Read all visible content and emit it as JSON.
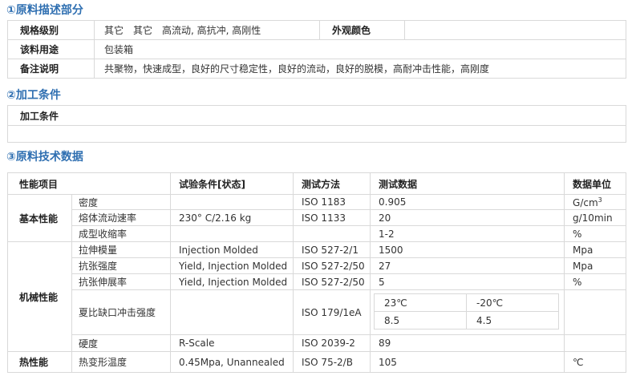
{
  "section1": {
    "title": "①原料描述部分",
    "rows": [
      {
        "label": "规格级别",
        "value": "其它　其它　高流动, 高抗冲, 高刚性",
        "label2": "外观颜色",
        "value2": ""
      },
      {
        "label": "该料用途",
        "value": "包装箱"
      },
      {
        "label": "备注说明",
        "value": "共聚物，快速成型，良好的尺寸稳定性，良好的流动，良好的脱模，高耐冲击性能，高刚度"
      }
    ]
  },
  "section2": {
    "title": "②加工条件",
    "header": "加工条件",
    "value": ""
  },
  "section3": {
    "title": "③原料技术数据",
    "headers": {
      "property": "性能项目",
      "condition": "试验条件[状态]",
      "method": "测试方法",
      "data": "测试数据",
      "unit": "数据单位"
    },
    "groups": {
      "basic": "基本性能",
      "mechanical": "机械性能",
      "thermal": "热性能"
    },
    "rows": [
      {
        "item": "密度",
        "condition": "",
        "method": "ISO 1183",
        "data": "0.905",
        "unit": "G/cm",
        "unit_sup": "3"
      },
      {
        "item": "熔体流动速率",
        "condition": "230°  C/2.16 kg",
        "method": "ISO 1133",
        "data": "20",
        "unit": "g/10min"
      },
      {
        "item": "成型收缩率",
        "condition": "",
        "method": "",
        "data": "1-2",
        "unit": "%"
      },
      {
        "item": "拉伸模量",
        "condition": "Injection Molded",
        "method": "ISO 527-2/1",
        "data": "1500",
        "unit": "Mpa"
      },
      {
        "item": "抗张强度",
        "condition": "Yield, Injection Molded",
        "method": "ISO 527-2/50",
        "data": "27",
        "unit": "Mpa"
      },
      {
        "item": "抗张伸展率",
        "condition": "Yield, Injection Molded",
        "method": "ISO 527-2/50",
        "data": "5",
        "unit": "%"
      },
      {
        "item": "夏比缺口冲击强度",
        "condition": "",
        "method": "ISO 179/1eA",
        "sub": {
          "temp1": "23℃",
          "temp2": "-20℃",
          "val1": "8.5",
          "val2": "4.5"
        },
        "unit": ""
      },
      {
        "item": "硬度",
        "condition": "R-Scale",
        "method": "ISO 2039-2",
        "data": "89",
        "unit": ""
      },
      {
        "item": "热变形温度",
        "condition": "0.45Mpa, Unannealed",
        "method": "ISO 75-2/B",
        "data": "105",
        "unit": "℃"
      }
    ]
  }
}
